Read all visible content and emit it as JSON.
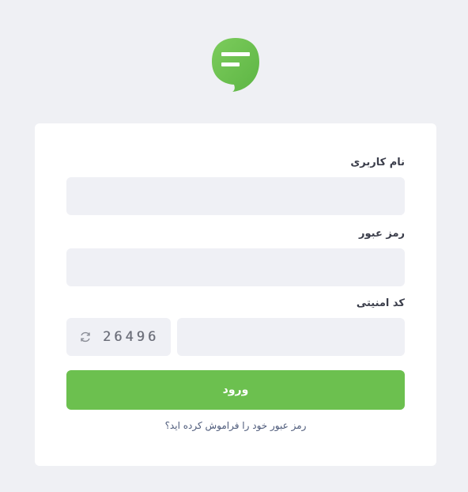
{
  "brand": {
    "logo_color": "#6cc04f"
  },
  "form": {
    "username_label": "نام کاربری",
    "username_value": "",
    "password_label": "رمز عبور",
    "password_value": "",
    "captcha_label": "کد امنیتی",
    "captcha_value": "",
    "captcha_code": "26496",
    "submit_label": "ورود",
    "forgot_link": "رمز عبور خود را فراموش کرده اید؟"
  },
  "icons": {
    "logo": "chat-bubble-icon",
    "refresh": "refresh-icon"
  },
  "colors": {
    "background": "#eff0f4",
    "card": "#ffffff",
    "field": "#eff0f5",
    "accent": "#6cc04f"
  }
}
